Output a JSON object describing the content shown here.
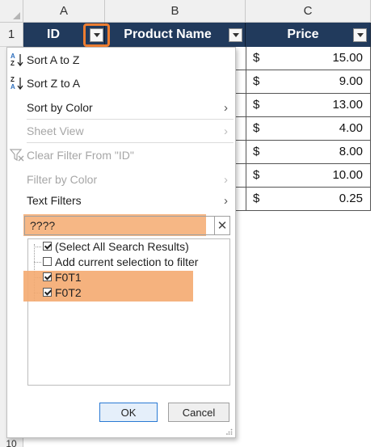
{
  "columns": [
    "A",
    "B",
    "C"
  ],
  "rows": [
    "1"
  ],
  "last_row": "10",
  "headers": {
    "id": "ID",
    "product_name": "Product Name",
    "price": "Price"
  },
  "prices": [
    {
      "currency": "$",
      "amount": "15.00"
    },
    {
      "currency": "$",
      "amount": "9.00"
    },
    {
      "currency": "$",
      "amount": "13.00"
    },
    {
      "currency": "$",
      "amount": "4.00"
    },
    {
      "currency": "$",
      "amount": "8.00"
    },
    {
      "currency": "$",
      "amount": "10.00"
    },
    {
      "currency": "$",
      "amount": "0.25"
    }
  ],
  "menu": {
    "sort_az": "Sort A to Z",
    "sort_za": "Sort Z to A",
    "sort_by_color": "Sort by Color",
    "sheet_view": "Sheet View",
    "clear_filter": "Clear Filter From \"ID\"",
    "filter_by_color": "Filter by Color",
    "text_filters": "Text Filters",
    "submenu_glyph": "›",
    "search_value": "????",
    "clear_glyph": "✕",
    "list": [
      {
        "label": "(Select All Search Results)",
        "checked": true
      },
      {
        "label": "Add current selection to filter",
        "checked": false
      },
      {
        "label": "F0T1",
        "checked": true
      },
      {
        "label": "F0T2",
        "checked": true
      }
    ],
    "ok": "OK",
    "cancel": "Cancel"
  },
  "colors": {
    "header_fill": "#213a5c",
    "highlight": "#f4aa70",
    "ring": "#ed7d31"
  },
  "icons": [
    "sort-az-icon",
    "sort-za-icon",
    "clear-filter-icon",
    "filter-dropdown-icon",
    "close-icon",
    "resize-grip-icon"
  ]
}
